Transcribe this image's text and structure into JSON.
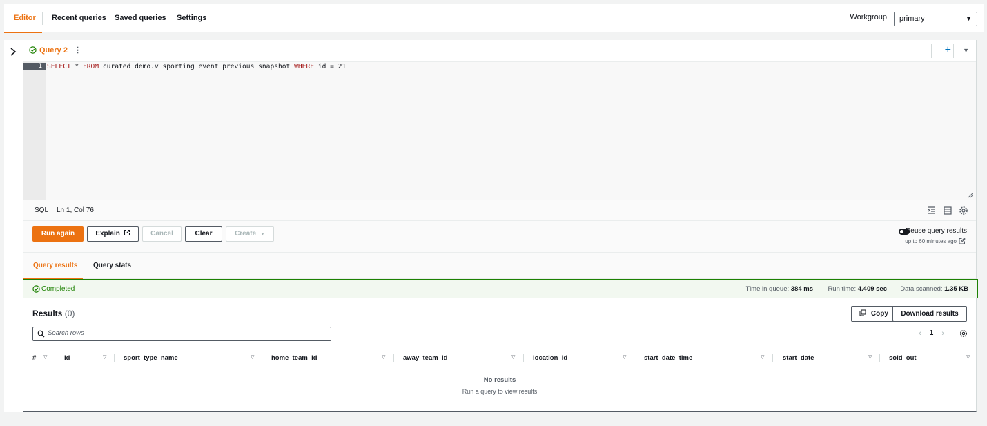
{
  "nav": {
    "tabs": [
      {
        "label": "Editor"
      },
      {
        "label": "Recent queries"
      },
      {
        "label": "Saved queries"
      },
      {
        "label": "Settings"
      }
    ],
    "workgroup_label": "Workgroup",
    "workgroup_value": "primary"
  },
  "editor": {
    "query_tab_label": "Query 2",
    "line_number": "1",
    "sql": {
      "kw_select": "SELECT",
      "star": " * ",
      "kw_from": "FROM",
      "table": " curated_demo.v_sporting_event_previous_snapshot ",
      "kw_where": "WHERE",
      "cond": " id = 21"
    },
    "language": "SQL",
    "cursor_position": "Ln 1, Col 76"
  },
  "actions": {
    "run": "Run again",
    "explain": "Explain",
    "cancel": "Cancel",
    "clear": "Clear",
    "create": "Create",
    "reuse_label": "Reuse query results",
    "reuse_sub": "up to 60 minutes ago"
  },
  "result_tabs": {
    "results": "Query results",
    "stats": "Query stats"
  },
  "status": {
    "text": "Completed",
    "time_in_queue_label": "Time in queue:",
    "time_in_queue": "384 ms",
    "run_time_label": "Run time:",
    "run_time": "4.409 sec",
    "data_scanned_label": "Data scanned:",
    "data_scanned": "1.35 KB"
  },
  "results": {
    "title": "Results",
    "count": "(0)",
    "copy": "Copy",
    "download": "Download results",
    "search_placeholder": "Search rows",
    "page": "1",
    "columns": [
      "#",
      "id",
      "sport_type_name",
      "home_team_id",
      "away_team_id",
      "location_id",
      "start_date_time",
      "start_date",
      "sold_out"
    ],
    "empty_title": "No results",
    "empty_sub": "Run a query to view results"
  },
  "colors": {
    "accent": "#ec7211",
    "success": "#1d8102",
    "link": "#0073bb"
  }
}
